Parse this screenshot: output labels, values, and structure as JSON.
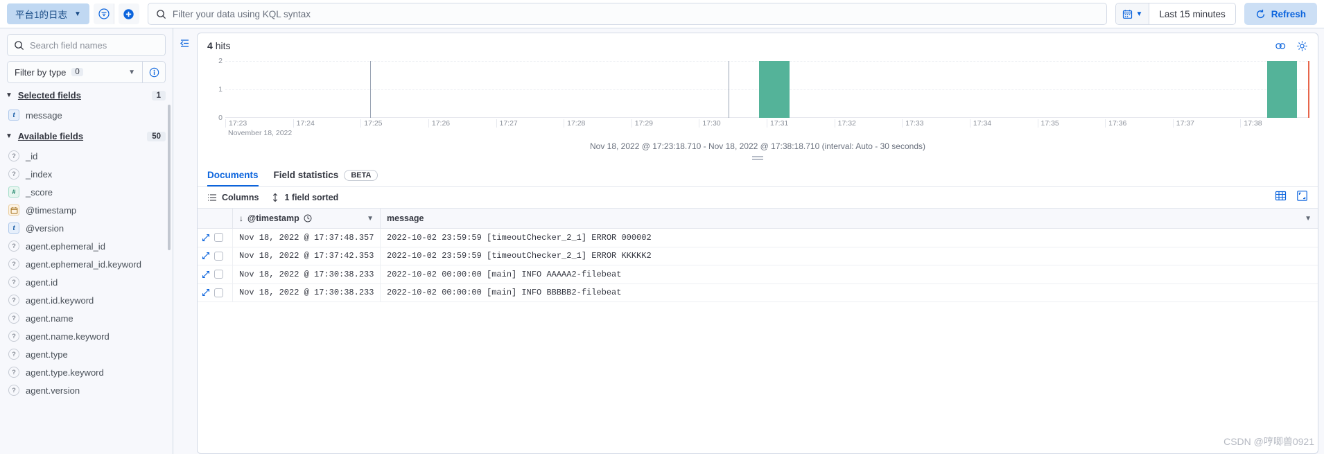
{
  "topbar": {
    "dataview": "平台1的日志",
    "dataview_icon": "chevron-down-icon",
    "filter_icon": "filter-icon",
    "add_icon": "plus-circle-icon",
    "search_icon": "search-icon",
    "query_placeholder": "Filter your data using KQL syntax",
    "query_value": "",
    "calendar_icon": "calendar-icon",
    "time_range": "Last 15 minutes",
    "refresh_icon": "refresh-icon",
    "refresh_label": "Refresh"
  },
  "sidebar": {
    "search_placeholder": "Search field names",
    "search_value": "",
    "filter_by_type_label": "Filter by type",
    "filter_by_type_count": "0",
    "info_icon": "info-circle-icon",
    "selected_fields": {
      "title": "Selected fields",
      "count": "1",
      "fields": [
        {
          "name": "message",
          "type": "string"
        }
      ]
    },
    "available_fields": {
      "title": "Available fields",
      "count": "50",
      "fields": [
        {
          "name": "_id",
          "type": "unknown"
        },
        {
          "name": "_index",
          "type": "unknown"
        },
        {
          "name": "_score",
          "type": "number"
        },
        {
          "name": "@timestamp",
          "type": "date"
        },
        {
          "name": "@version",
          "type": "string"
        },
        {
          "name": "agent.ephemeral_id",
          "type": "unknown"
        },
        {
          "name": "agent.ephemeral_id.keyword",
          "type": "unknown"
        },
        {
          "name": "agent.id",
          "type": "unknown"
        },
        {
          "name": "agent.id.keyword",
          "type": "unknown"
        },
        {
          "name": "agent.name",
          "type": "unknown"
        },
        {
          "name": "agent.name.keyword",
          "type": "unknown"
        },
        {
          "name": "agent.type",
          "type": "unknown"
        },
        {
          "name": "agent.type.keyword",
          "type": "unknown"
        },
        {
          "name": "agent.version",
          "type": "unknown"
        }
      ]
    }
  },
  "main": {
    "collapse_icon": "collapse-sidebar-icon",
    "hits_count": "4",
    "hits_label": "hits",
    "chart_options_icon": "chart-type-icon",
    "gear_icon": "gear-icon",
    "range_label": "Nov 18, 2022 @ 17:23:18.710 - Nov 18, 2022 @ 17:38:18.710 (interval: Auto - 30 seconds)",
    "tabs": [
      {
        "label": "Documents",
        "active": true
      },
      {
        "label": "Field statistics",
        "active": false,
        "badge": "BETA"
      }
    ],
    "toolbar": {
      "columns_label": "Columns",
      "columns_icon": "columns-icon",
      "sort_label": "1 field sorted",
      "sort_icon": "sort-icon",
      "density_icon": "density-icon",
      "fullscreen_icon": "fullscreen-icon"
    },
    "table": {
      "headers": [
        {
          "label": "",
          "name": "row-controls"
        },
        {
          "label": "@timestamp",
          "name": "timestamp",
          "sort_icon": "arrow-down-icon",
          "clock_icon": "clock-icon",
          "menu_icon": "chevron-down-icon"
        },
        {
          "label": "message",
          "name": "message",
          "menu_icon": "chevron-down-icon"
        }
      ],
      "rows": [
        {
          "timestamp": "Nov 18, 2022 @ 17:37:48.357",
          "message": "2022-10-02 23:59:59 [timeoutChecker_2_1] ERROR 000002"
        },
        {
          "timestamp": "Nov 18, 2022 @ 17:37:42.353",
          "message": "2022-10-02 23:59:59 [timeoutChecker_2_1] ERROR KKKKK2"
        },
        {
          "timestamp": "Nov 18, 2022 @ 17:30:38.233",
          "message": "2022-10-02 00:00:00 [main] INFO AAAAA2-filebeat"
        },
        {
          "timestamp": "Nov 18, 2022 @ 17:30:38.233",
          "message": "2022-10-02 00:00:00 [main] INFO BBBBB2-filebeat"
        }
      ]
    }
  },
  "chart_data": {
    "type": "bar",
    "title": "4 hits",
    "xlabel": "November 18, 2022",
    "ylabel": "",
    "ylim": [
      0,
      2
    ],
    "yticks": [
      "0",
      "1",
      "2"
    ],
    "grid": true,
    "bar_color": "#54B399",
    "interval": "Auto - 30 seconds",
    "x_range": [
      "Nov 18, 2022 @ 17:23:18.710",
      "Nov 18, 2022 @ 17:38:18.710"
    ],
    "categories": [
      "17:23",
      "17:24",
      "17:25",
      "17:26",
      "17:27",
      "17:28",
      "17:29",
      "17:30",
      "17:31",
      "17:32",
      "17:33",
      "17:34",
      "17:35",
      "17:36",
      "17:37",
      "17:38"
    ],
    "bars": [
      {
        "x": "17:30:30",
        "value": 2,
        "left_pct": 49.3,
        "width_pct": 2.8
      },
      {
        "x": "17:37:30",
        "value": 2,
        "left_pct": 96.2,
        "width_pct": 2.8
      }
    ],
    "markers": [
      {
        "type": "vline",
        "x": "17:25",
        "left_pct": 13.4
      },
      {
        "type": "vline",
        "x": "17:30",
        "left_pct": 46.5
      },
      {
        "type": "endline",
        "x": "17:38:18",
        "left_pct": 100.0,
        "color": "#E7664C"
      }
    ]
  },
  "watermark": "CSDN @哼唧兽0921"
}
